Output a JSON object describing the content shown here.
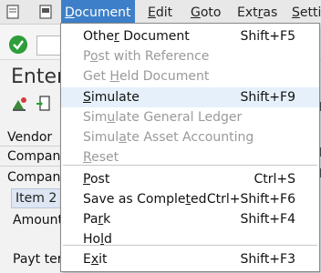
{
  "menubar": {
    "items": [
      {
        "label": "Document",
        "mnemonic_index": 0,
        "active": true
      },
      {
        "label": "Edit",
        "mnemonic_index": 0
      },
      {
        "label": "Goto",
        "mnemonic_index": 0
      },
      {
        "label": "Extras",
        "mnemonic_index": 3
      },
      {
        "label": "Setti",
        "mnemonic_index": 0
      }
    ]
  },
  "background": {
    "page_title": "Enter",
    "fields": {
      "vendor": "Vendor",
      "company1": "Company",
      "company2": "Company",
      "tab": "Item 2 /",
      "amount": "Amount",
      "payt": "Payt ter"
    }
  },
  "dropdown": {
    "items": [
      {
        "label": "Other Document",
        "shortcut": "Shift+F5",
        "disabled": false,
        "ul": 4
      },
      {
        "label": "Post with Reference",
        "shortcut": "",
        "disabled": true,
        "ul": 1
      },
      {
        "label": "Get Held Document",
        "shortcut": "",
        "disabled": true,
        "ul": 4
      },
      {
        "label": "Simulate",
        "shortcut": "Shift+F9",
        "disabled": false,
        "hover": true,
        "ul": 0
      },
      {
        "label": "Simulate General Ledger",
        "shortcut": "",
        "disabled": true,
        "ul": 3
      },
      {
        "label": "Simulate Asset Accounting",
        "shortcut": "",
        "disabled": true,
        "ul": 5
      },
      {
        "label": "Reset",
        "shortcut": "",
        "disabled": true,
        "ul": 0
      },
      {
        "label": "Post",
        "shortcut": "Ctrl+S",
        "disabled": false,
        "ul": 0
      },
      {
        "label": "Save as Completed",
        "shortcut": "Ctrl+Shift+F6",
        "disabled": false,
        "ul": 14
      },
      {
        "label": "Park",
        "shortcut": "Shift+F4",
        "disabled": false,
        "ul": 2
      },
      {
        "label": "Hold",
        "shortcut": "",
        "disabled": false,
        "ul": 2
      },
      {
        "label": "Exit",
        "shortcut": "Shift+F3",
        "disabled": false,
        "ul": 1
      }
    ]
  }
}
